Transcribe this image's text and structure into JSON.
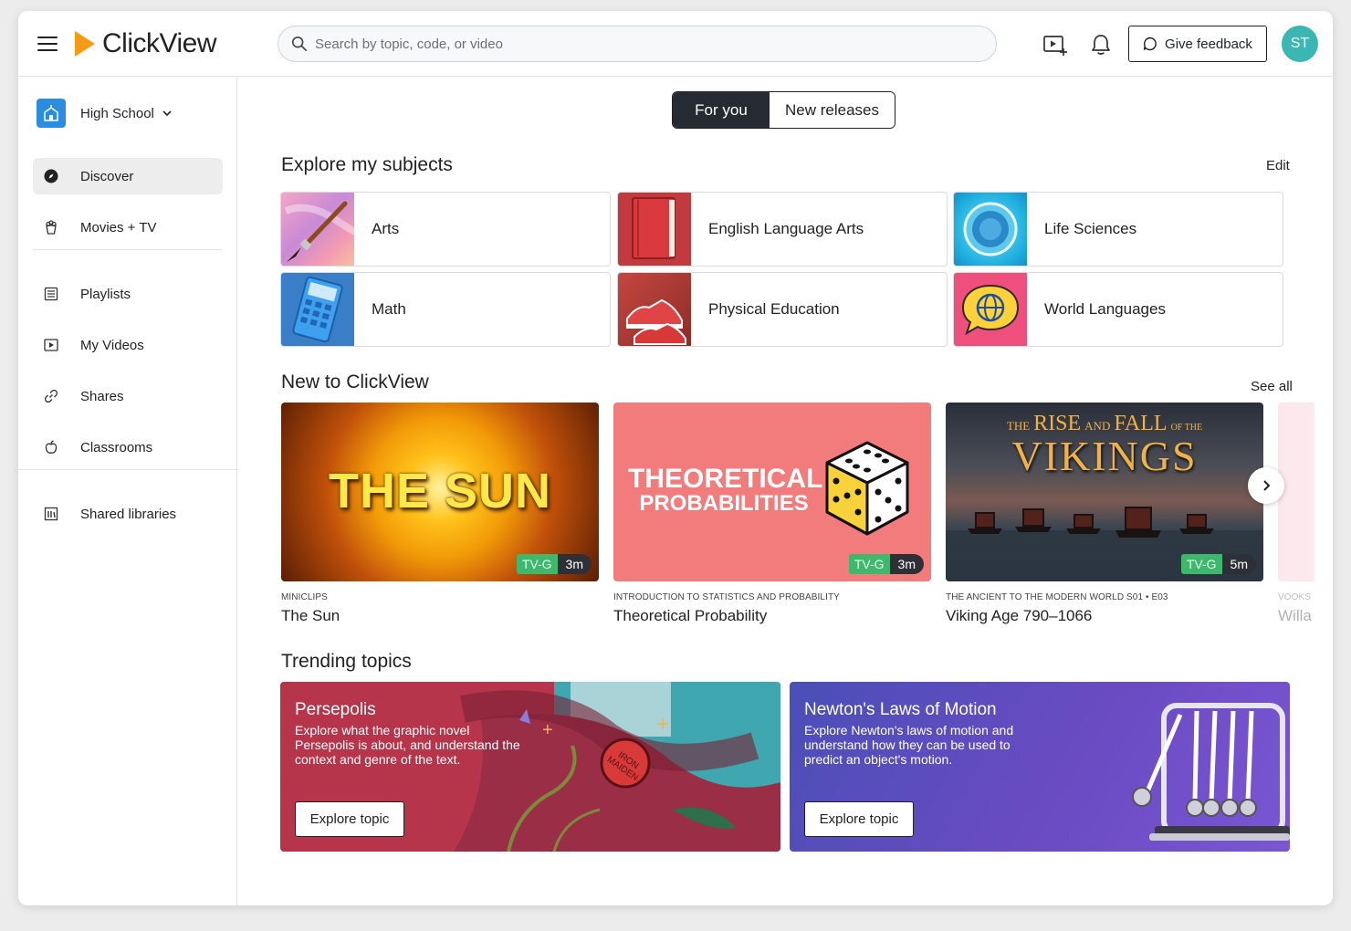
{
  "app": {
    "name": "ClickView"
  },
  "header": {
    "search_placeholder": "Search by topic, code, or video",
    "feedback_label": "Give feedback",
    "avatar_initials": "ST"
  },
  "sidebar": {
    "school_label": "High School",
    "items": [
      {
        "label": "Discover",
        "icon": "compass-icon",
        "active": true
      },
      {
        "label": "Movies + TV",
        "icon": "popcorn-icon"
      },
      {
        "label": "Playlists",
        "icon": "list-icon"
      },
      {
        "label": "My Videos",
        "icon": "play-square-icon"
      },
      {
        "label": "Shares",
        "icon": "link-icon"
      },
      {
        "label": "Classrooms",
        "icon": "apple-icon"
      },
      {
        "label": "Shared libraries",
        "icon": "library-icon"
      }
    ]
  },
  "tabs": {
    "active": "For you",
    "inactive": "New releases"
  },
  "subjects": {
    "title": "Explore my subjects",
    "edit_label": "Edit",
    "items": [
      "Arts",
      "English Language Arts",
      "Life Sciences",
      "Math",
      "Physical Education",
      "World Languages"
    ]
  },
  "new_section": {
    "title": "New to ClickView",
    "see_all": "See all",
    "videos": [
      {
        "series": "MINICLIPS",
        "title": "The Sun",
        "rating": "TV-G",
        "duration": "3m",
        "thumb_text": "THE SUN"
      },
      {
        "series": "INTRODUCTION TO STATISTICS AND PROBABILITY",
        "title": "Theoretical Probability",
        "rating": "TV-G",
        "duration": "3m",
        "thumb_line1": "THEORETICAL",
        "thumb_line2": "PROBABILITIES"
      },
      {
        "series": "THE ANCIENT TO THE MODERN WORLD S01 • E03",
        "title": "Viking Age 790–1066",
        "rating": "TV-G",
        "duration": "5m",
        "thumb_small1": "THE",
        "thumb_big1": "RISE",
        "thumb_small2": "AND",
        "thumb_big2": "FALL",
        "thumb_small3": "OF THE",
        "thumb_main": "VIKINGS"
      },
      {
        "series": "VOOKS",
        "title": "Willa"
      }
    ]
  },
  "trending": {
    "title": "Trending topics",
    "topics": [
      {
        "title": "Persepolis",
        "description": "Explore what the graphic novel Persepolis is about, and understand the context and genre of the text.",
        "button": "Explore topic",
        "patch_text": "IRON MAIDEN"
      },
      {
        "title": "Newton's Laws of Motion",
        "description": "Explore Newton's laws of motion and understand how they can be used to predict an object's motion.",
        "button": "Explore topic"
      }
    ]
  }
}
